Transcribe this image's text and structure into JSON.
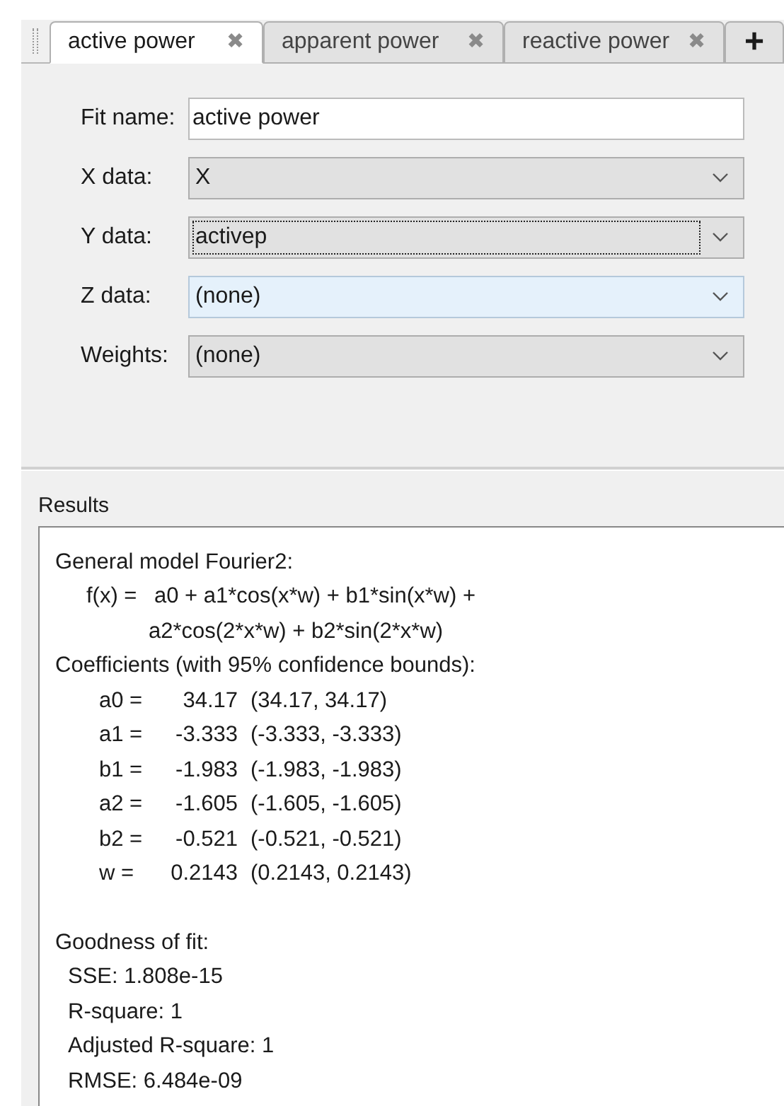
{
  "tabs": [
    {
      "label": "active power",
      "selected": true,
      "close": "✖"
    },
    {
      "label": "apparent power",
      "selected": false,
      "close": "✖"
    },
    {
      "label": "reactive power",
      "selected": false,
      "close": "✖"
    }
  ],
  "add_tab": "+",
  "fields": [
    {
      "kind": "text",
      "label": "Fit name:",
      "value": "active power"
    },
    {
      "kind": "dropdown",
      "label": "X data:",
      "value": "X",
      "focused": false,
      "highlighted": false
    },
    {
      "kind": "dropdown",
      "label": "Y data:",
      "value": "activep",
      "focused": true,
      "highlighted": false
    },
    {
      "kind": "dropdown",
      "label": "Z data:",
      "value": "(none)",
      "focused": false,
      "highlighted": true
    },
    {
      "kind": "dropdown",
      "label": "Weights:",
      "value": "(none)",
      "focused": false,
      "highlighted": false
    }
  ],
  "results": {
    "title": "Results",
    "model": "General model Fourier2:",
    "formula": {
      "lhs": "f(x) =",
      "line_1": "a0 + a1*cos(x*w) + b1*sin(x*w) +",
      "line_2": "a2*cos(2*x*w) + b2*sin(2*x*w)"
    },
    "coefficients_heading": "Coefficients (with 95% confidence bounds):",
    "coefficients": [
      {
        "name": "a0 =",
        "value": "34.17",
        "bounds": "(34.17, 34.17)"
      },
      {
        "name": "a1 =",
        "value": "-3.333",
        "bounds": "(-3.333, -3.333)"
      },
      {
        "name": "b1 =",
        "value": "-1.983",
        "bounds": "(-1.983, -1.983)"
      },
      {
        "name": "a2 =",
        "value": "-1.605",
        "bounds": "(-1.605, -1.605)"
      },
      {
        "name": "b2 =",
        "value": "-0.521",
        "bounds": "(-0.521, -0.521)"
      },
      {
        "name": "w =",
        "value": "0.2143",
        "bounds": "(0.2143, 0.2143)"
      }
    ],
    "goodness_heading": "Goodness of fit:",
    "goodness": [
      "SSE: 1.808e-15",
      "R-square: 1",
      "Adjusted R-square: 1",
      "RMSE: 6.484e-09"
    ]
  }
}
